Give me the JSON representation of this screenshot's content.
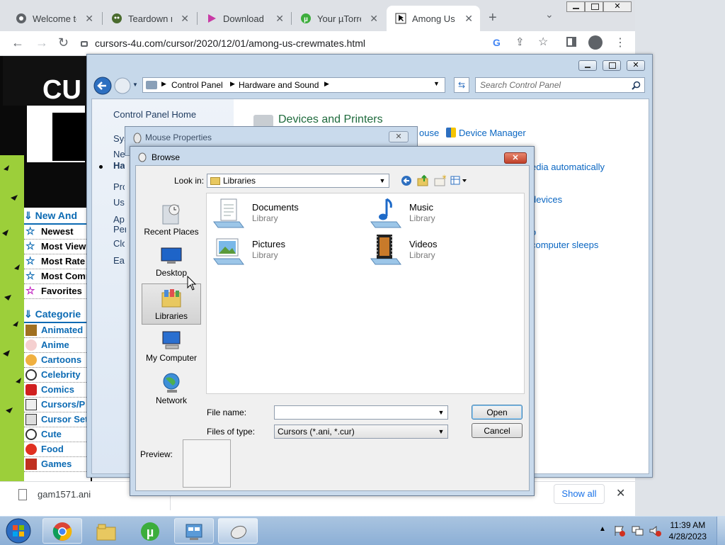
{
  "browser": {
    "tabs": [
      {
        "title": "Welcome to"
      },
      {
        "title": "Teardown no"
      },
      {
        "title": "Download D"
      },
      {
        "title": "Your µTorren"
      },
      {
        "title": "Among Us -"
      }
    ],
    "url": "cursors-4u.com/cursor/2020/12/01/among-us-crewmates.html"
  },
  "website": {
    "new_heading": "New And",
    "new_items": [
      "Newest",
      "Most View",
      "Most Rate",
      "Most Comm",
      "Favorites"
    ],
    "categories_heading": "Categorie",
    "categories": [
      "Animated",
      "Anime",
      "Cartoons",
      "Celebrity",
      "Comics",
      "Cursors/P",
      "Cursor Set",
      "Cute",
      "Food",
      "Games"
    ]
  },
  "downloads": {
    "file": "gam1571.ani",
    "show_all": "Show all"
  },
  "control_panel": {
    "breadcrumb": [
      "Control Panel",
      "Hardware and Sound"
    ],
    "search_placeholder": "Search Control Panel",
    "home": "Control Panel Home",
    "left_links": [
      "Sys",
      "Ne",
      "Ha",
      "Pro",
      "Use",
      "Ap",
      "Per",
      "Clo",
      "Eas"
    ],
    "devices_title": "Devices and Printers",
    "links": {
      "mouse": "ouse",
      "device_manager": "Device Manager",
      "media": "edia automatically",
      "devices": "devices",
      "o": "o",
      "sleeps": "computer sleeps"
    }
  },
  "mouse_properties": {
    "title": "Mouse Properties"
  },
  "browse": {
    "title": "Browse",
    "look_in_label": "Look in:",
    "look_in_value": "Libraries",
    "places": [
      "Recent Places",
      "Desktop",
      "Libraries",
      "My Computer",
      "Network"
    ],
    "libraries": [
      {
        "name": "Documents",
        "type": "Library"
      },
      {
        "name": "Music",
        "type": "Library"
      },
      {
        "name": "Pictures",
        "type": "Library"
      },
      {
        "name": "Videos",
        "type": "Library"
      }
    ],
    "file_name_label": "File name:",
    "file_name_value": "",
    "files_of_type_label": "Files of type:",
    "files_of_type_value": "Cursors (*.ani, *.cur)",
    "open_label": "Open",
    "cancel_label": "Cancel",
    "preview_label": "Preview:"
  },
  "taskbar": {
    "time": "11:39 AM",
    "date": "4/28/2023"
  },
  "colors": {
    "link_blue": "#0a66c2",
    "site_blue": "#0b6ab3",
    "taskbar": "#8cafd6"
  }
}
